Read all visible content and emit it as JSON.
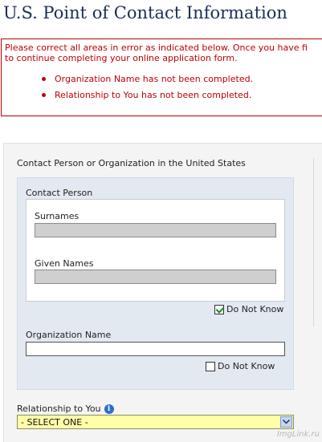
{
  "page": {
    "title": "U.S. Point of Contact Information"
  },
  "errors": {
    "message_line1": "Please correct all areas in error as indicated below. Once you have fi",
    "message_line2": "to continue completing your online application form.",
    "items": [
      "Organization Name has not been completed.",
      "Relationship to You has not been completed."
    ]
  },
  "form": {
    "section_heading": "Contact Person or Organization in the United States",
    "contact_person": {
      "label": "Contact Person",
      "surnames_label": "Surnames",
      "surnames_value": "",
      "given_names_label": "Given Names",
      "given_names_value": "",
      "do_not_know_label": "Do Not Know",
      "do_not_know_checked": true
    },
    "organization": {
      "label": "Organization Name",
      "value": "",
      "do_not_know_label": "Do Not Know",
      "do_not_know_checked": false
    },
    "relationship": {
      "label": "Relationship to You",
      "info_icon": "info-icon",
      "selected": "- SELECT ONE -"
    }
  },
  "watermark": "ImgLink.ru",
  "colors": {
    "title": "#1b2d5a",
    "error": "#c00000",
    "panel_blue": "#e3e9f1",
    "select_highlight": "#ffffa8"
  }
}
